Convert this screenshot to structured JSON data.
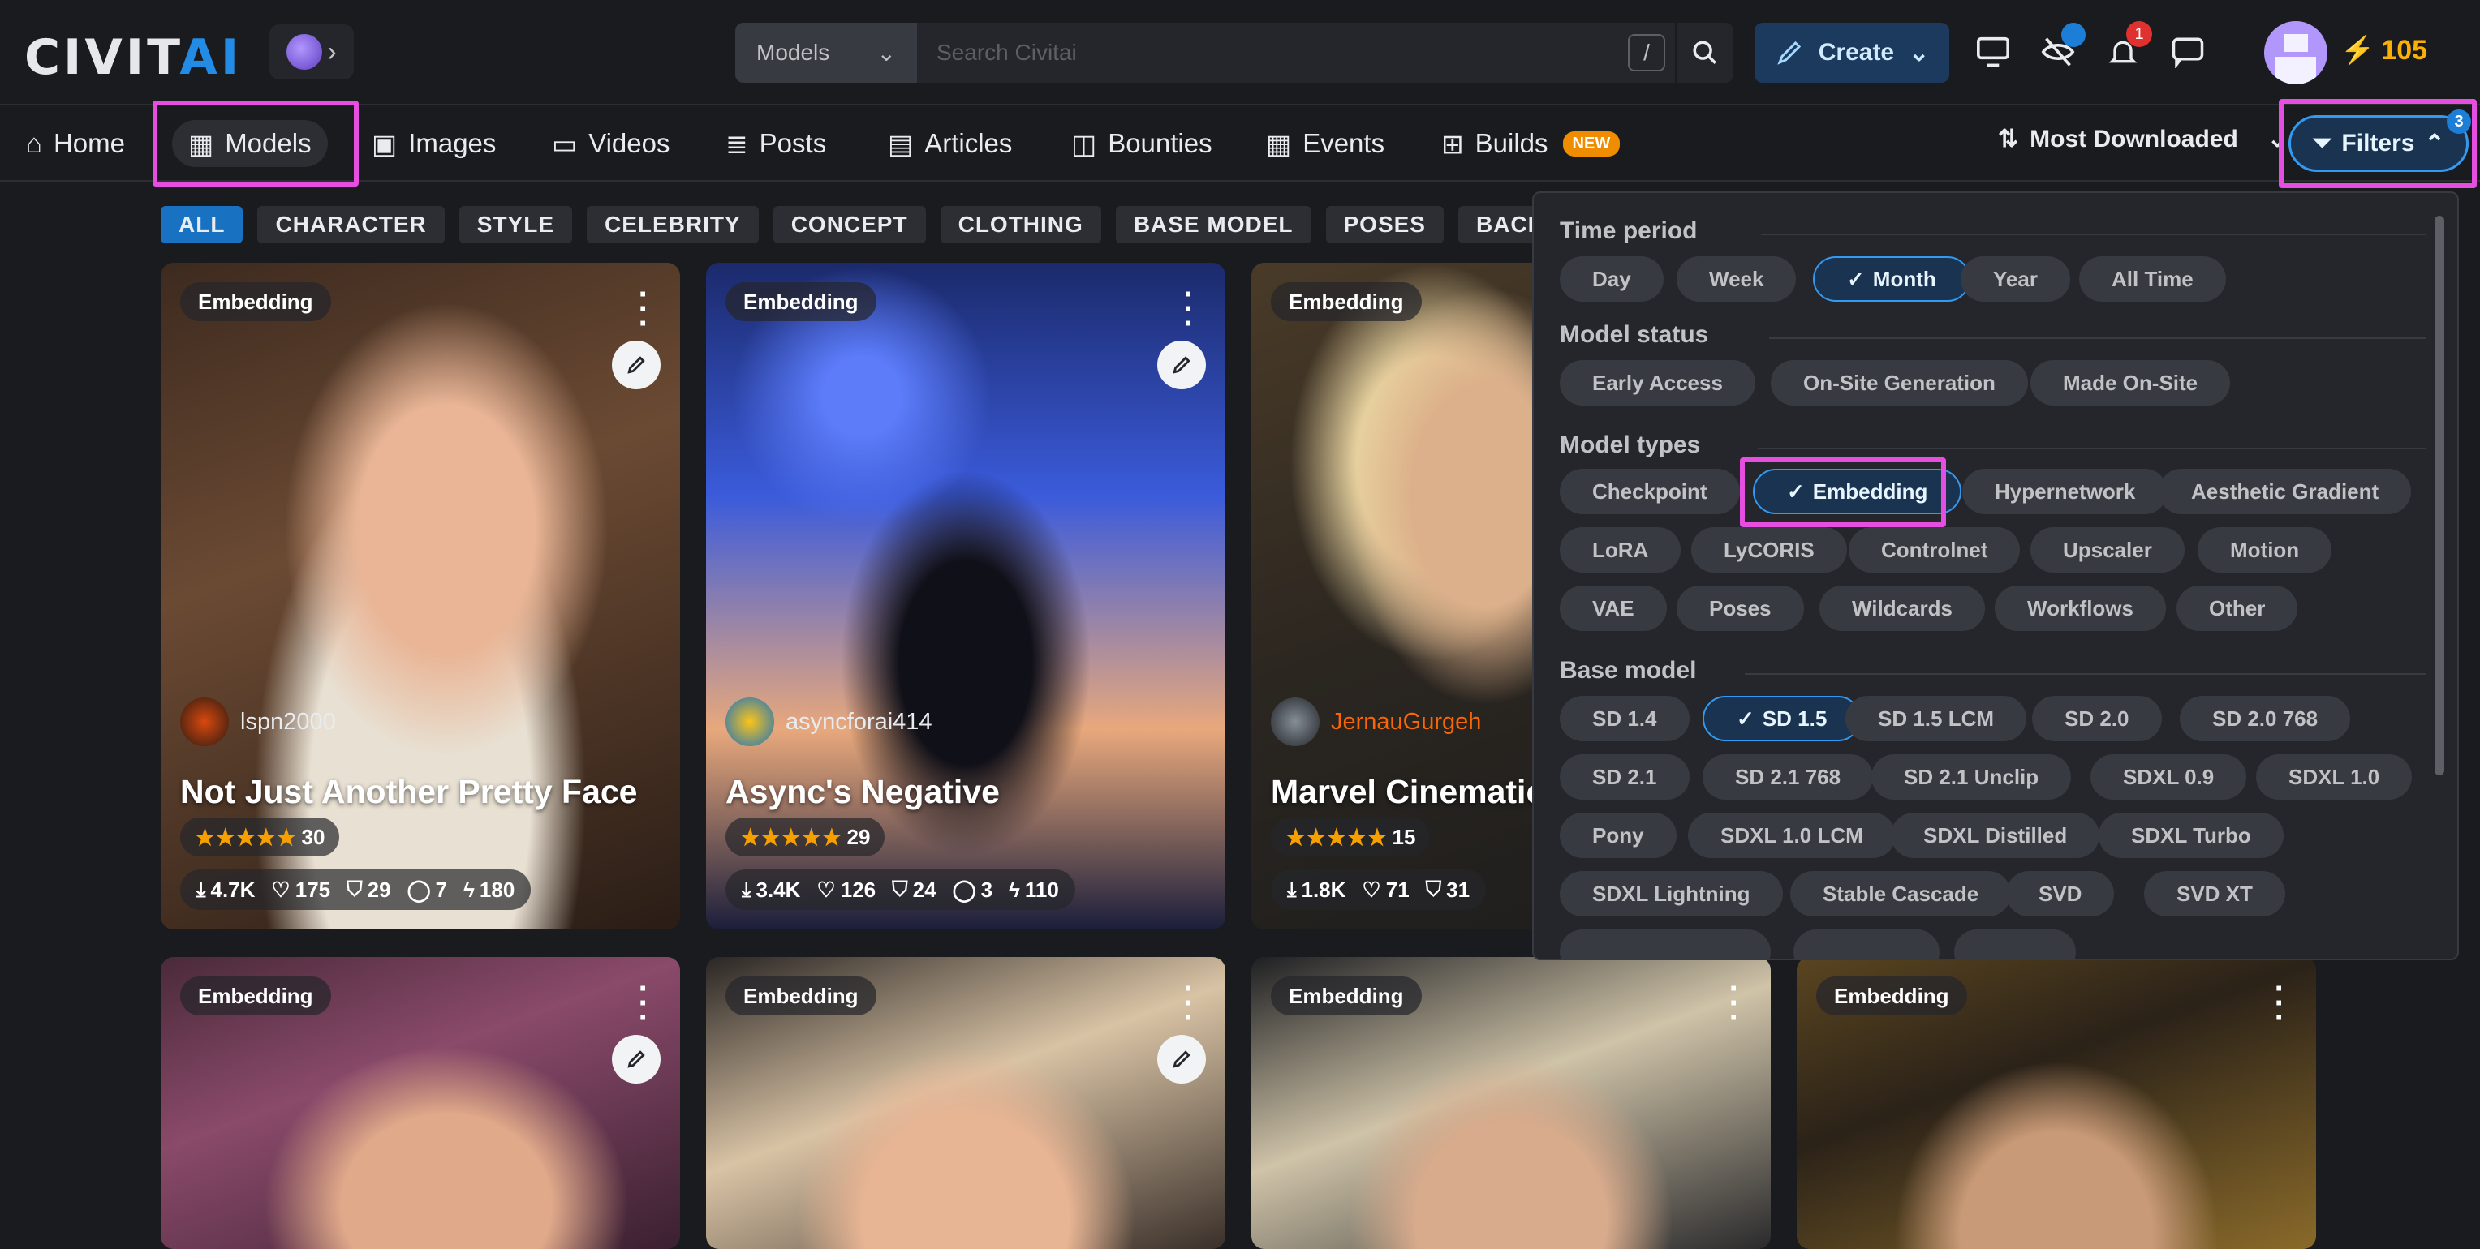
{
  "header": {
    "logo_main": "CIVIT",
    "logo_ai": "AI",
    "search_type": "Models",
    "search_placeholder": "Search Civitai",
    "search_shortcut": "/",
    "create_label": "Create",
    "notification_count": "1",
    "buzz_amount": "105"
  },
  "nav": {
    "items": [
      {
        "label": "Home"
      },
      {
        "label": "Models"
      },
      {
        "label": "Images"
      },
      {
        "label": "Videos"
      },
      {
        "label": "Posts"
      },
      {
        "label": "Articles"
      },
      {
        "label": "Bounties"
      },
      {
        "label": "Events"
      },
      {
        "label": "Builds"
      }
    ],
    "builds_badge": "NEW",
    "sort_label": "Most Downloaded",
    "filters_label": "Filters",
    "filters_count": "3"
  },
  "categories": [
    "ALL",
    "CHARACTER",
    "STYLE",
    "CELEBRITY",
    "CONCEPT",
    "CLOTHING",
    "BASE MODEL",
    "POSES",
    "BACKGROUND"
  ],
  "cards": [
    {
      "type": "Embedding",
      "user": "lspn2000",
      "title": "Not Just Another Pretty Face",
      "rating_count": "30",
      "downloads": "4.7K",
      "likes": "175",
      "saves": "29",
      "comments": "7",
      "buzz": "180"
    },
    {
      "type": "Embedding",
      "user": "asyncforai414",
      "title": "Async's Negative",
      "rating_count": "29",
      "downloads": "3.4K",
      "likes": "126",
      "saves": "24",
      "comments": "3",
      "buzz": "110"
    },
    {
      "type": "Embedding",
      "user": "JernauGurgeh",
      "title": "Marvel Cinematic",
      "rating_count": "15",
      "downloads": "1.8K",
      "likes": "71",
      "saves": "31"
    },
    {
      "type": "Embedding"
    },
    {
      "type": "Embedding"
    },
    {
      "type": "Embedding"
    },
    {
      "type": "Embedding"
    }
  ],
  "filters": {
    "time_period": {
      "label": "Time period",
      "options": [
        "Day",
        "Week",
        "Month",
        "Year",
        "All Time"
      ],
      "selected": "Month"
    },
    "model_status": {
      "label": "Model status",
      "options": [
        "Early Access",
        "On-Site Generation",
        "Made On-Site"
      ]
    },
    "model_types": {
      "label": "Model types",
      "options": [
        "Checkpoint",
        "Embedding",
        "Hypernetwork",
        "Aesthetic Gradient",
        "LoRA",
        "LyCORIS",
        "Controlnet",
        "Upscaler",
        "Motion",
        "VAE",
        "Poses",
        "Wildcards",
        "Workflows",
        "Other"
      ],
      "selected": "Embedding"
    },
    "base_model": {
      "label": "Base model",
      "options": [
        "SD 1.4",
        "SD 1.5",
        "SD 1.5 LCM",
        "SD 2.0",
        "SD 2.0 768",
        "SD 2.1",
        "SD 2.1 768",
        "SD 2.1 Unclip",
        "SDXL 0.9",
        "SDXL 1.0",
        "Pony",
        "SDXL 1.0 LCM",
        "SDXL Distilled",
        "SDXL Turbo",
        "SDXL Lightning",
        "Stable Cascade",
        "SVD",
        "SVD XT"
      ],
      "selected": "SD 1.5"
    }
  },
  "colors": {
    "accent": "#339af0",
    "highlight": "#e64ee0",
    "star": "#f59f00",
    "buzz": "#fab005"
  }
}
